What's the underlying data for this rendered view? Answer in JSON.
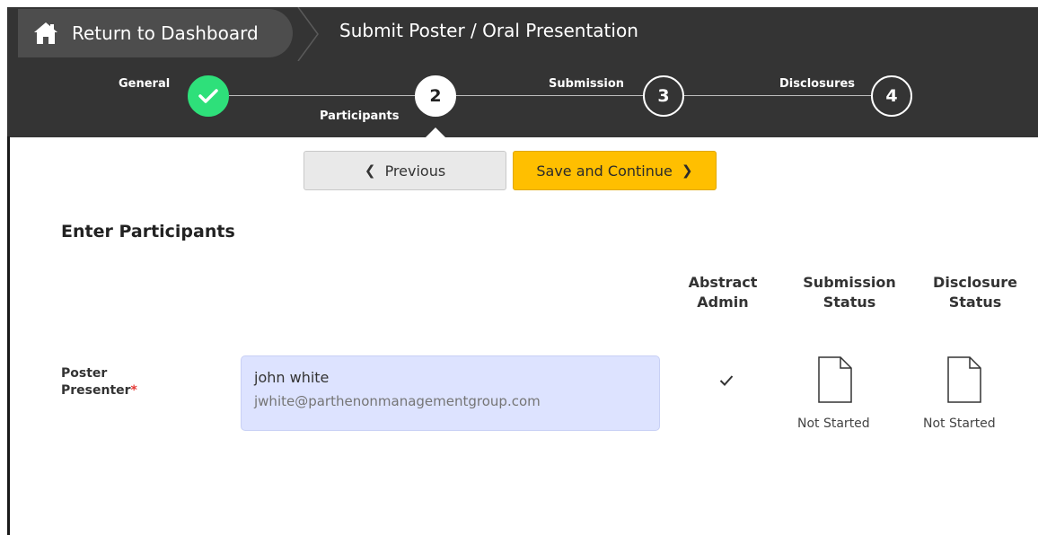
{
  "header": {
    "return_label": "Return to Dashboard",
    "page_title": "Submit Poster / Oral Presentation"
  },
  "stepper": {
    "steps": [
      {
        "label": "General",
        "number": "",
        "state": "complete"
      },
      {
        "label": "Participants",
        "number": "2",
        "state": "active"
      },
      {
        "label": "Submission",
        "number": "3",
        "state": "upcoming"
      },
      {
        "label": "Disclosures",
        "number": "4",
        "state": "upcoming"
      }
    ]
  },
  "nav": {
    "previous_label": "Previous",
    "save_label": "Save and Continue"
  },
  "section": {
    "title": "Enter Participants"
  },
  "columns": {
    "abstract_admin": [
      "Abstract",
      "Admin"
    ],
    "submission_status": [
      "Submission",
      "Status"
    ],
    "disclosure_status": [
      "Disclosure",
      "Status"
    ]
  },
  "participant": {
    "role_line1": "Poster",
    "role_line2": "Presenter",
    "required_mark": "*",
    "name": "john white",
    "email": "jwhite@parthenonmanagementgroup.com",
    "abstract_admin": true,
    "submission_status": "Not Started",
    "disclosure_status": "Not Started"
  },
  "colors": {
    "header_bg": "#343434",
    "complete_green": "#2ee07a",
    "save_yellow": "#ffbf00",
    "participant_bg": "#dde3ff",
    "required_red": "#e53935"
  },
  "icons": {
    "home": "home-icon",
    "check": "check-icon",
    "document": "document-icon",
    "chevron_left": "chevron-left-icon",
    "chevron_right": "chevron-right-icon"
  }
}
